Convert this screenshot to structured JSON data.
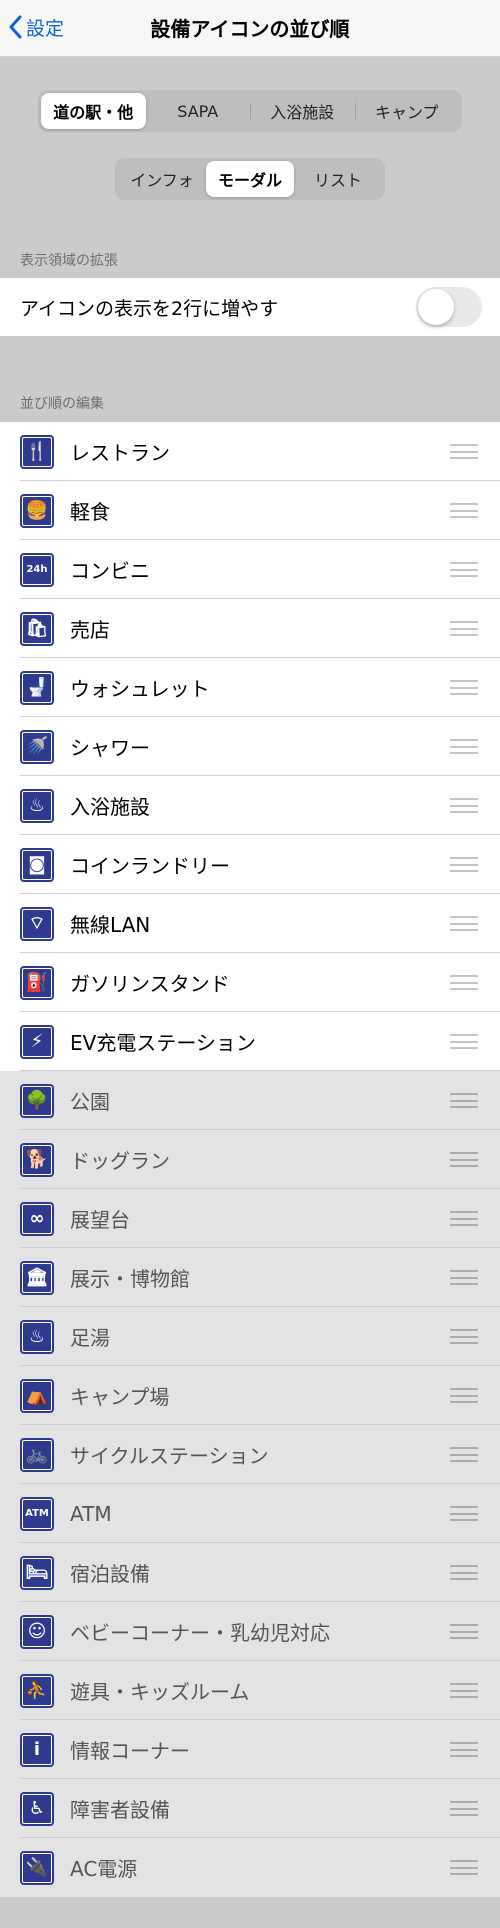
{
  "nav": {
    "back_label": "設定",
    "title": "設備アイコンの並び順"
  },
  "category_tabs": [
    "道の駅・他",
    "SAPA",
    "入浴施設",
    "キャンプ"
  ],
  "category_selected": 0,
  "view_tabs": [
    "インフォ",
    "モーダル",
    "リスト"
  ],
  "view_selected": 1,
  "sections": {
    "display_header": "表示領域の拡張",
    "order_header": "並び順の編集"
  },
  "toggle": {
    "label": "アイコンの表示を2行に増やす",
    "on": false
  },
  "enabled_items": [
    {
      "label": "レストラン",
      "icon": "restaurant-icon",
      "glyph": "🍴"
    },
    {
      "label": "軽食",
      "icon": "snack-icon",
      "glyph": "🍔"
    },
    {
      "label": "コンビニ",
      "icon": "convenience-store-icon",
      "glyph": "24h"
    },
    {
      "label": "売店",
      "icon": "shop-icon",
      "glyph": "🛍"
    },
    {
      "label": "ウォシュレット",
      "icon": "washlet-icon",
      "glyph": "🚽"
    },
    {
      "label": "シャワー",
      "icon": "shower-icon",
      "glyph": "🚿"
    },
    {
      "label": "入浴施設",
      "icon": "bath-icon",
      "glyph": "♨"
    },
    {
      "label": "コインランドリー",
      "icon": "laundry-icon",
      "glyph": "◙"
    },
    {
      "label": "無線LAN",
      "icon": "wifi-icon",
      "glyph": "⌔"
    },
    {
      "label": "ガソリンスタンド",
      "icon": "gas-station-icon",
      "glyph": "⛽"
    },
    {
      "label": "EV充電ステーション",
      "icon": "ev-charger-icon",
      "glyph": "⚡"
    }
  ],
  "disabled_items": [
    {
      "label": "公園",
      "icon": "park-icon",
      "glyph": "🌳"
    },
    {
      "label": "ドッグラン",
      "icon": "dog-run-icon",
      "glyph": "🐕"
    },
    {
      "label": "展望台",
      "icon": "binoculars-icon",
      "glyph": "∞"
    },
    {
      "label": "展示・博物館",
      "icon": "museum-icon",
      "glyph": "🏛"
    },
    {
      "label": "足湯",
      "icon": "foot-bath-icon",
      "glyph": "♨"
    },
    {
      "label": "キャンプ場",
      "icon": "tent-icon",
      "glyph": "⛺"
    },
    {
      "label": "サイクルステーション",
      "icon": "bicycle-icon",
      "glyph": "🚲"
    },
    {
      "label": "ATM",
      "icon": "atm-icon",
      "glyph": "ATM"
    },
    {
      "label": "宿泊設備",
      "icon": "bed-icon",
      "glyph": "🛏"
    },
    {
      "label": "ベビーコーナー・乳幼児対応",
      "icon": "baby-icon",
      "glyph": "☺"
    },
    {
      "label": "遊具・キッズルーム",
      "icon": "playground-icon",
      "glyph": "⛹"
    },
    {
      "label": "情報コーナー",
      "icon": "info-icon",
      "glyph": "i"
    },
    {
      "label": "障害者設備",
      "icon": "wheelchair-icon",
      "glyph": "♿"
    },
    {
      "label": "AC電源",
      "icon": "power-plug-icon",
      "glyph": "🔌"
    }
  ],
  "colors": {
    "accent": "#0a63d8",
    "icon_bg": "#2f3a8e",
    "page_bg": "#cbcbcb",
    "disabled_row_bg": "#e3e3e3"
  }
}
